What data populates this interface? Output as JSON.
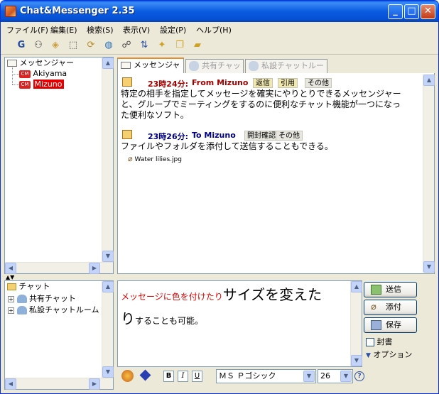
{
  "window": {
    "title": "Chat&Messenger 2.35",
    "minimize": "_",
    "maximize": "□",
    "close": "✕"
  },
  "menu": [
    "ファイル(F)",
    "編集(E)",
    "検索(S)",
    "表示(V)",
    "設定(P)",
    "ヘルプ(H)"
  ],
  "toolbar": [
    "g-icon",
    "users-icon",
    "tag-icon",
    "select-icon",
    "refresh-icon",
    "globe-icon",
    "group-icon",
    "sort-icon",
    "folder-star-icon",
    "copy-icon",
    "folder-open-icon"
  ],
  "users_tree": {
    "root": "メッセンジャー",
    "users": [
      {
        "name": "Akiyama",
        "selected": false
      },
      {
        "name": "Mizuno",
        "selected": true
      }
    ]
  },
  "chat_tree": {
    "root": "チャット",
    "items": [
      "共有チャット",
      "私設チャットルーム"
    ]
  },
  "tabs": [
    {
      "label": "メッセンジャー",
      "active": true
    },
    {
      "label": "共有チャット",
      "active": false
    },
    {
      "label": "私設チャットルーム",
      "active": false
    }
  ],
  "messages": [
    {
      "time": "23時24分:",
      "from": "From Mizuno",
      "buttons": [
        "返信",
        "引用",
        "その他"
      ],
      "lines": [
        "特定の相手を指定してメッセージを確実にやりとりできるメッセンジャー",
        "と、グループでミーティングをするのに便利なチャット機能が一つになっ",
        "た便利なソフト。"
      ]
    },
    {
      "time": "23時26分:",
      "from": "To Mizuno",
      "buttons": [
        "開封確認",
        "その他"
      ],
      "lines": [
        "ファイルやフォルダを添付して送信することもできる。"
      ],
      "attachment": "Water lilies.jpg"
    }
  ],
  "compose": {
    "red_text": "メッセージに色を付けたり",
    "big_text": "サイズを変えた",
    "big_text2": "り",
    "small_text": "することも可能。"
  },
  "actions": {
    "send": "送信",
    "attach": "添付",
    "save": "保存",
    "seal": "封書",
    "options": "オプション"
  },
  "format": {
    "bold": "B",
    "italic": "I",
    "underline": "U",
    "font": "ＭＳ Ｐゴシック",
    "size": "26",
    "help": "?"
  },
  "colors": {
    "time_red": "#a00000",
    "from_blue": "#000080",
    "compose_red": "#e00000",
    "selected_bg": "#e00000"
  }
}
